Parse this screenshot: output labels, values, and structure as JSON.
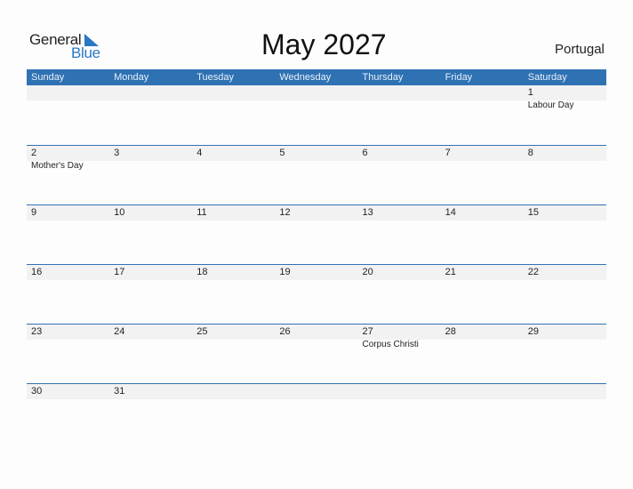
{
  "brand": {
    "line1": "General",
    "line2": "Blue",
    "accent": "#2a78c4"
  },
  "title": "May 2027",
  "country": "Portugal",
  "colors": {
    "header_bg": "#2f72b3",
    "date_strip": "#f2f2f2"
  },
  "weekdays": [
    "Sunday",
    "Monday",
    "Tuesday",
    "Wednesday",
    "Thursday",
    "Friday",
    "Saturday"
  ],
  "weeks": [
    [
      {
        "day": "",
        "holiday": ""
      },
      {
        "day": "",
        "holiday": ""
      },
      {
        "day": "",
        "holiday": ""
      },
      {
        "day": "",
        "holiday": ""
      },
      {
        "day": "",
        "holiday": ""
      },
      {
        "day": "",
        "holiday": ""
      },
      {
        "day": "1",
        "holiday": "Labour Day"
      }
    ],
    [
      {
        "day": "2",
        "holiday": "Mother's Day"
      },
      {
        "day": "3",
        "holiday": ""
      },
      {
        "day": "4",
        "holiday": ""
      },
      {
        "day": "5",
        "holiday": ""
      },
      {
        "day": "6",
        "holiday": ""
      },
      {
        "day": "7",
        "holiday": ""
      },
      {
        "day": "8",
        "holiday": ""
      }
    ],
    [
      {
        "day": "9",
        "holiday": ""
      },
      {
        "day": "10",
        "holiday": ""
      },
      {
        "day": "11",
        "holiday": ""
      },
      {
        "day": "12",
        "holiday": ""
      },
      {
        "day": "13",
        "holiday": ""
      },
      {
        "day": "14",
        "holiday": ""
      },
      {
        "day": "15",
        "holiday": ""
      }
    ],
    [
      {
        "day": "16",
        "holiday": ""
      },
      {
        "day": "17",
        "holiday": ""
      },
      {
        "day": "18",
        "holiday": ""
      },
      {
        "day": "19",
        "holiday": ""
      },
      {
        "day": "20",
        "holiday": ""
      },
      {
        "day": "21",
        "holiday": ""
      },
      {
        "day": "22",
        "holiday": ""
      }
    ],
    [
      {
        "day": "23",
        "holiday": ""
      },
      {
        "day": "24",
        "holiday": ""
      },
      {
        "day": "25",
        "holiday": ""
      },
      {
        "day": "26",
        "holiday": ""
      },
      {
        "day": "27",
        "holiday": "Corpus Christi"
      },
      {
        "day": "28",
        "holiday": ""
      },
      {
        "day": "29",
        "holiday": ""
      }
    ],
    [
      {
        "day": "30",
        "holiday": ""
      },
      {
        "day": "31",
        "holiday": ""
      },
      {
        "day": "",
        "holiday": ""
      },
      {
        "day": "",
        "holiday": ""
      },
      {
        "day": "",
        "holiday": ""
      },
      {
        "day": "",
        "holiday": ""
      },
      {
        "day": "",
        "holiday": ""
      }
    ]
  ]
}
